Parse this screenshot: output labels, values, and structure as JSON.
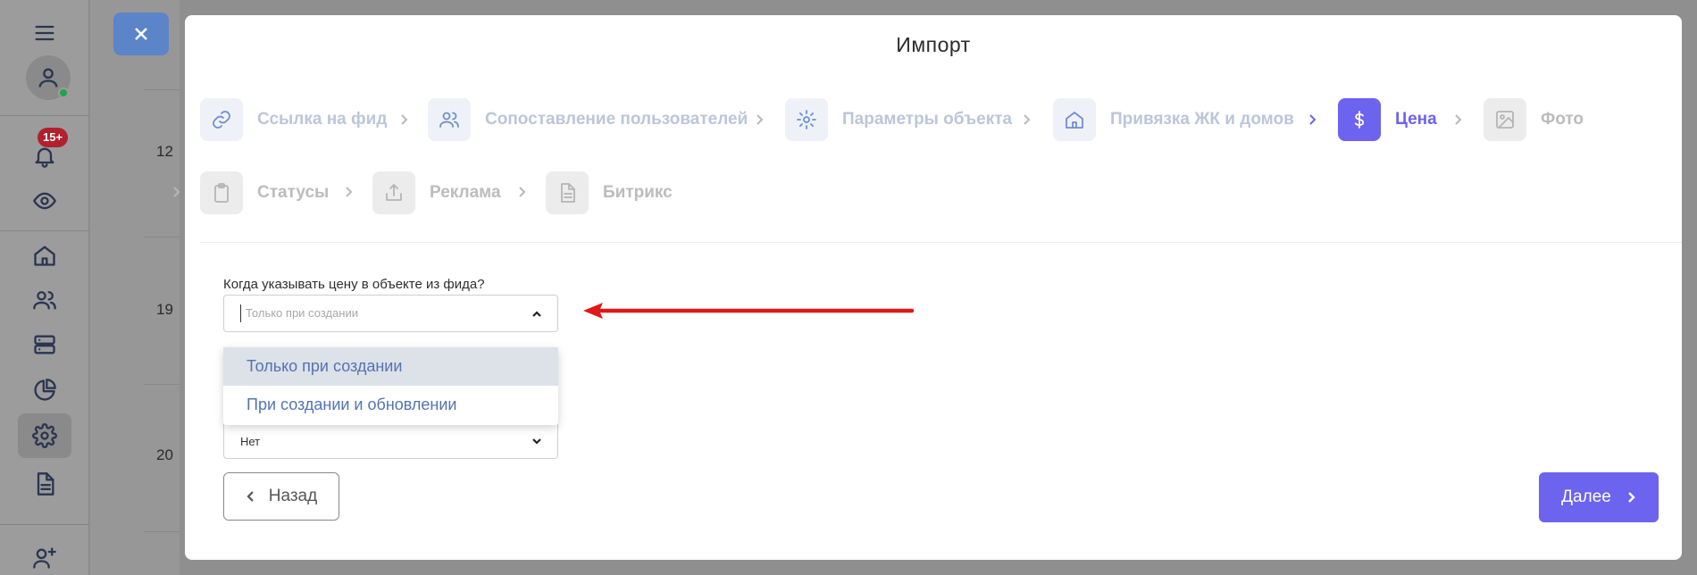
{
  "sidebar": {
    "notification_count": "15+"
  },
  "background": {
    "row_numbers": [
      "12",
      "19",
      "20"
    ]
  },
  "modal": {
    "title": "Импорт",
    "steps": [
      {
        "label": "Ссылка на фид",
        "icon": "link-icon",
        "state": "done"
      },
      {
        "label": "Сопоставление пользователей",
        "icon": "users-icon",
        "state": "done"
      },
      {
        "label": "Параметры объекта",
        "icon": "gear-icon",
        "state": "done"
      },
      {
        "label": "Привязка ЖК и домов",
        "icon": "home-icon",
        "state": "done"
      },
      {
        "label": "Цена",
        "icon": "dollar-icon",
        "state": "active"
      },
      {
        "label": "Фото",
        "icon": "image-icon",
        "state": "pending"
      },
      {
        "label": "Статусы",
        "icon": "clipboard-icon",
        "state": "pending"
      },
      {
        "label": "Реклама",
        "icon": "upload-icon",
        "state": "pending"
      },
      {
        "label": "Битрикс",
        "icon": "document-icon",
        "state": "pending"
      }
    ],
    "price_field": {
      "label": "Когда указывать цену в объекте из фида?",
      "placeholder": "Только при создании",
      "options": [
        "Только при создании",
        "При создании и обновлении"
      ],
      "highlighted_option": "Только при создании"
    },
    "second_field": {
      "value": "Нет"
    },
    "buttons": {
      "back": "Назад",
      "next": "Далее"
    }
  },
  "colors": {
    "accent": "#6c63ef",
    "step_done_text": "#bcc6d9",
    "arrow": "#e01818"
  }
}
